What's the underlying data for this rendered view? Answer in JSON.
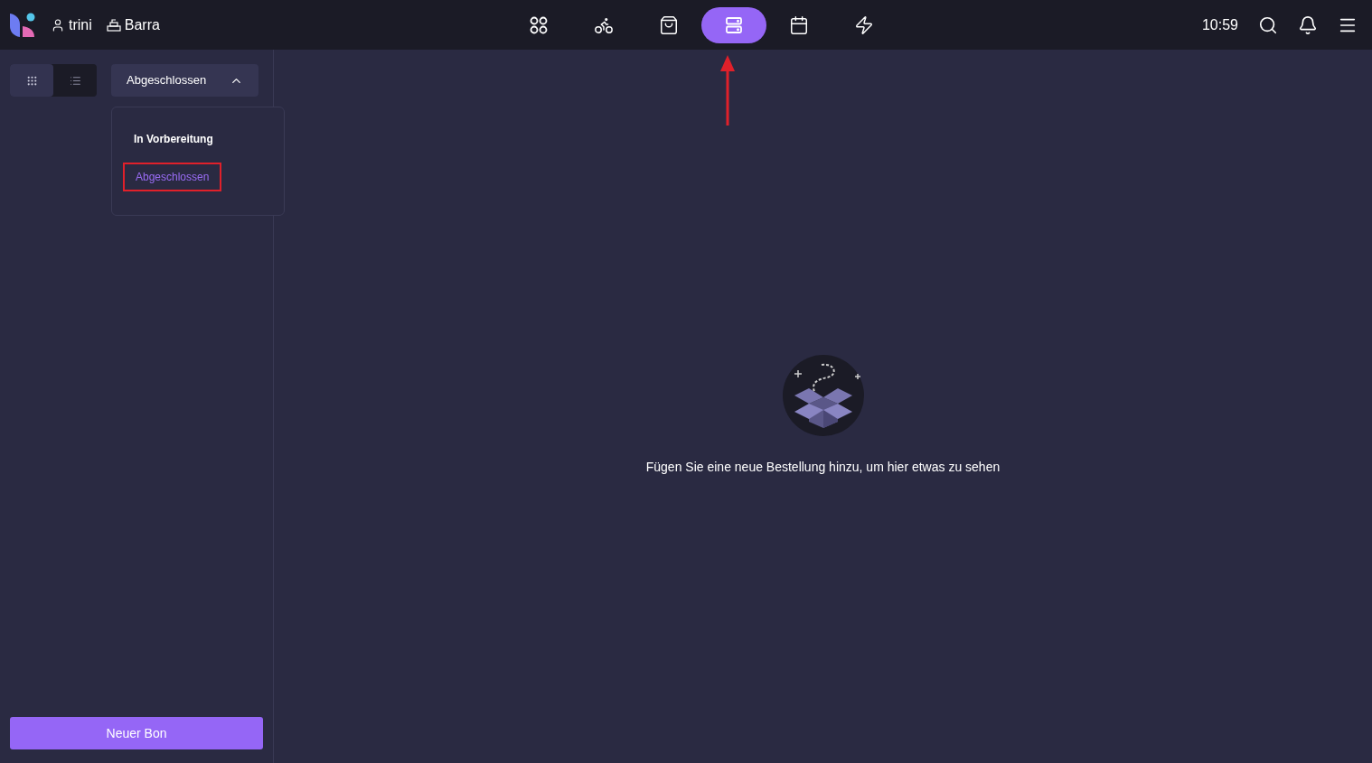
{
  "header": {
    "user": "trini",
    "register": "Barra",
    "nav": [
      {
        "kind": "grid",
        "selected": false
      },
      {
        "kind": "bike",
        "selected": false
      },
      {
        "kind": "bag",
        "selected": false
      },
      {
        "kind": "orders",
        "selected": true
      },
      {
        "kind": "calendar",
        "selected": false
      },
      {
        "kind": "bolt",
        "selected": false
      }
    ],
    "time": "10:59"
  },
  "sidebar": {
    "views": [
      {
        "kind": "grid",
        "selected": true
      },
      {
        "kind": "list",
        "selected": false
      }
    ],
    "filter": {
      "value": "Abgeschlossen",
      "expanded": true,
      "options": [
        {
          "label": "In Vorbereitung",
          "selected": false
        },
        {
          "label": "Abgeschlossen",
          "selected": true
        }
      ]
    },
    "button": "Neuer Bon"
  },
  "empty_state": {
    "message": "Fügen Sie eine neue Bestellung hinzu, um hier etwas zu sehen"
  }
}
